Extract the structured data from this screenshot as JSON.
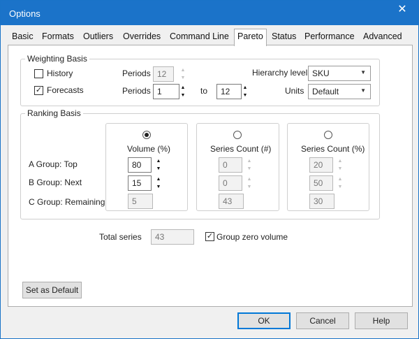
{
  "window": {
    "title": "Options",
    "close_glyph": "✕"
  },
  "tabs": [
    "Basic",
    "Formats",
    "Outliers",
    "Overrides",
    "Command Line",
    "Pareto",
    "Status",
    "Performance",
    "Advanced"
  ],
  "active_tab": "Pareto",
  "weighting": {
    "legend": "Weighting Basis",
    "history": {
      "label": "History",
      "checked": false,
      "periods_label": "Periods",
      "periods_value": "12"
    },
    "forecasts": {
      "label": "Forecasts",
      "checked": true,
      "periods_label": "Periods",
      "from_value": "1",
      "to_label": "to",
      "to_value": "12"
    },
    "hierarchy_label": "Hierarchy level",
    "hierarchy_value": "SKU",
    "units_label": "Units",
    "units_value": "Default"
  },
  "ranking": {
    "legend": "Ranking Basis",
    "rows": [
      "A Group: Top",
      "B Group: Next",
      "C Group: Remaining"
    ],
    "volume": {
      "title": "Volume (%)",
      "selected": true,
      "a": "80",
      "b": "15",
      "c": "5"
    },
    "series_count_num": {
      "title": "Series Count (#)",
      "selected": false,
      "a": "0",
      "b": "0",
      "c": "43"
    },
    "series_count_pct": {
      "title": "Series Count (%)",
      "selected": false,
      "a": "20",
      "b": "50",
      "c": "30"
    }
  },
  "total": {
    "label": "Total series",
    "value": "43",
    "group_zero_label": "Group zero volume",
    "group_zero_checked": true
  },
  "buttons": {
    "set_default": "Set as Default",
    "ok": "OK",
    "cancel": "Cancel",
    "help": "Help"
  },
  "glyphs": {
    "check": "✓",
    "up": "▲",
    "down": "▼",
    "dropdown": "▼"
  },
  "colors": {
    "titlebar": "#1b73c9",
    "focus_border": "#0078d7"
  }
}
